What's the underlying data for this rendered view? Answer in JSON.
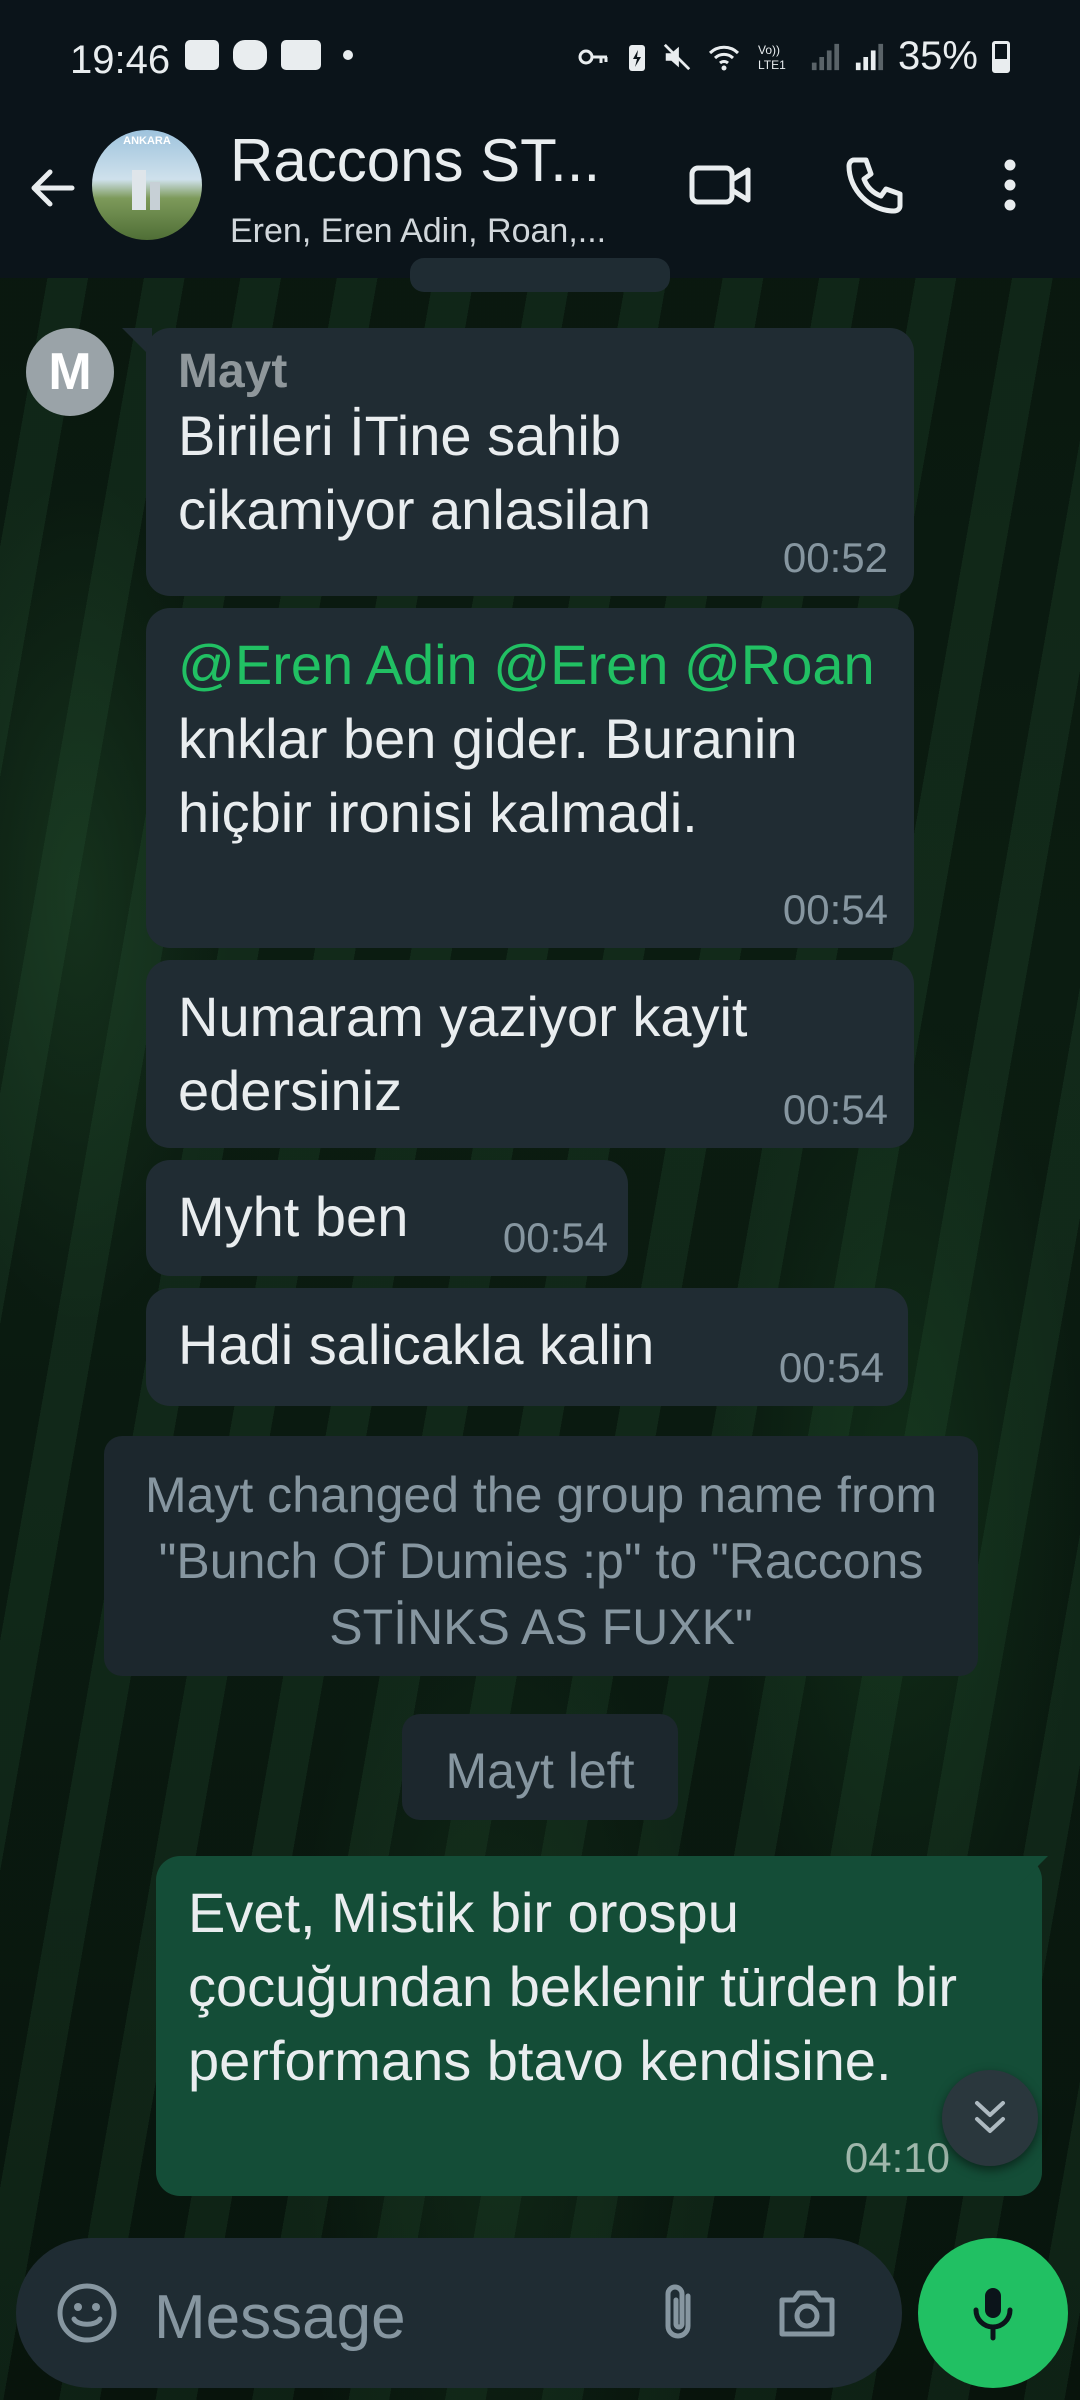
{
  "status_bar": {
    "time": "19:46",
    "battery": "35%",
    "net_label": "Vo)) LTE1"
  },
  "header": {
    "title": "Raccons ST...",
    "subtitle": "Eren, Eren Adin, Roan,...",
    "avatar_text": "ANKARA"
  },
  "sender_avatar": {
    "letter": "M"
  },
  "messages": [
    {
      "sender": "Mayt",
      "text": "Birileri İTine sahib cikamiyor anlasilan",
      "time": "00:52"
    },
    {
      "mentions": [
        "@Eren Adin",
        "@Eren",
        "@Roan"
      ],
      "text": " knklar ben gider. Buranin hiçbir ironisi kalmadi.",
      "time": "00:54"
    },
    {
      "text": "Numaram yaziyor kayit edersiniz",
      "time": "00:54"
    },
    {
      "text": "Myht ben",
      "time": "00:54"
    },
    {
      "text": "Hadi salicakla kalin",
      "time": "00:54"
    }
  ],
  "system_messages": [
    "Mayt changed the group name from \"Bunch Of Dumies :p\" to \"Raccons STİNKS AS FUXK\"",
    "Mayt left"
  ],
  "outgoing": {
    "text": "Evet, Mistik bir orospu çocuğundan beklenir türden bir performans btavo kendisine.",
    "time": "04:10"
  },
  "input": {
    "placeholder": "Message"
  },
  "colors": {
    "header_bg": "#0b141a",
    "incoming_bubble": "#202c33",
    "outgoing_bubble": "#144d37",
    "accent_green": "#21c063",
    "mention": "#21c063"
  }
}
